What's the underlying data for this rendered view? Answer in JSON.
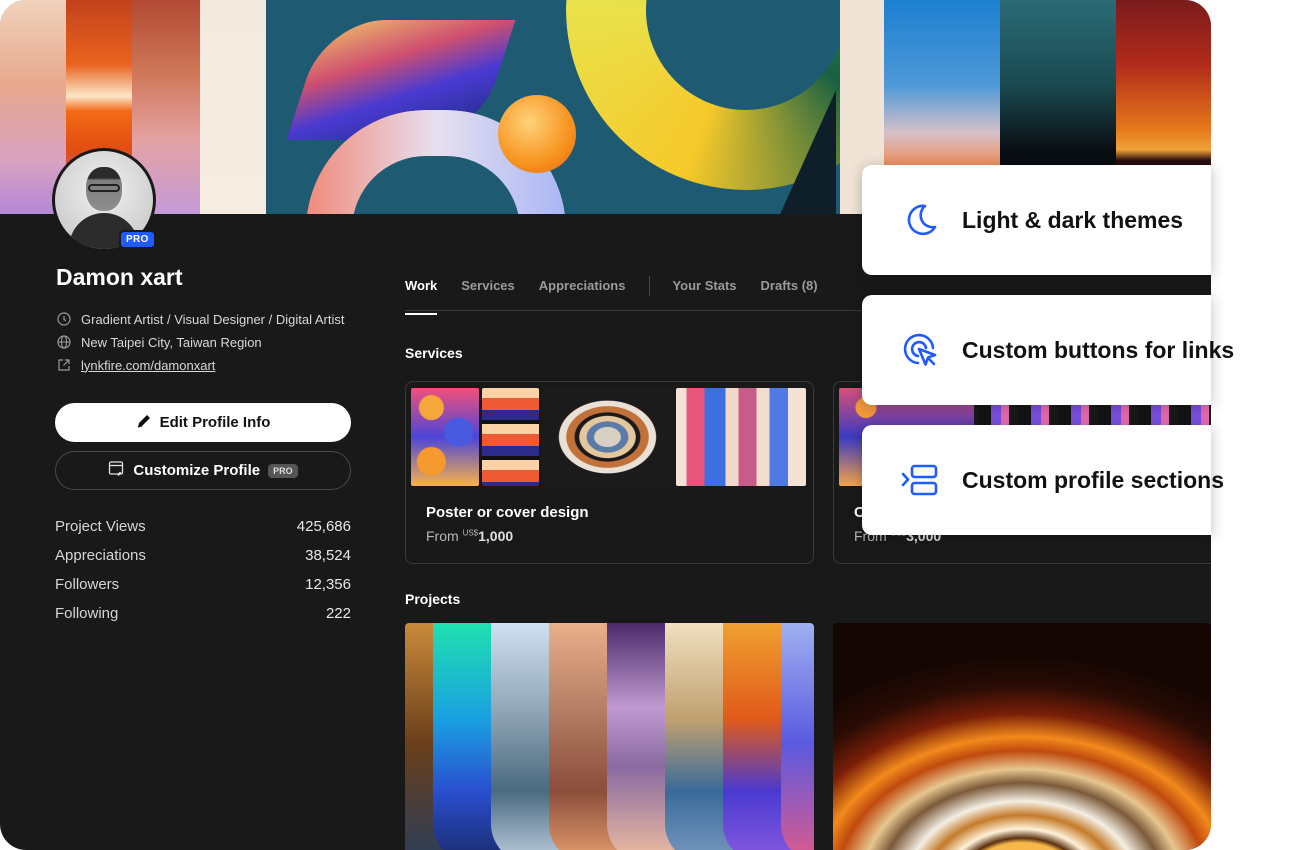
{
  "profile": {
    "name": "Damon xart",
    "badge": "PRO",
    "title_line": "Gradient Artist / Visual Designer / Digital Artist",
    "location": "New Taipei City, Taiwan Region",
    "website": "lynkfire.com/damonxart"
  },
  "actions": {
    "edit_label": "Edit Profile Info",
    "customize_label": "Customize Profile",
    "customize_badge": "PRO"
  },
  "stats": [
    {
      "label": "Project Views",
      "value": "425,686"
    },
    {
      "label": "Appreciations",
      "value": "38,524"
    },
    {
      "label": "Followers",
      "value": "12,356"
    },
    {
      "label": "Following",
      "value": "222"
    }
  ],
  "tabs": {
    "work": "Work",
    "services": "Services",
    "appreciations": "Appreciations",
    "your_stats": "Your Stats",
    "drafts": "Drafts (8)",
    "active": "work"
  },
  "sections": {
    "services": "Services",
    "projects": "Projects"
  },
  "services": [
    {
      "title": "Poster or cover design",
      "price_prefix": "From",
      "currency": "US$",
      "amount": "1,000"
    },
    {
      "title": "C",
      "price_prefix": "From",
      "currency": "US$",
      "amount": "3,000"
    }
  ],
  "features": [
    {
      "label": "Light & dark themes",
      "icon": "moon-icon"
    },
    {
      "label": "Custom buttons for links",
      "icon": "cursor-click-icon"
    },
    {
      "label": "Custom profile sections",
      "icon": "sections-icon"
    }
  ],
  "colors": {
    "accent_blue": "#1f5bff",
    "panel_dark": "#191919",
    "feature_icon_blue": "#1f5bff"
  }
}
